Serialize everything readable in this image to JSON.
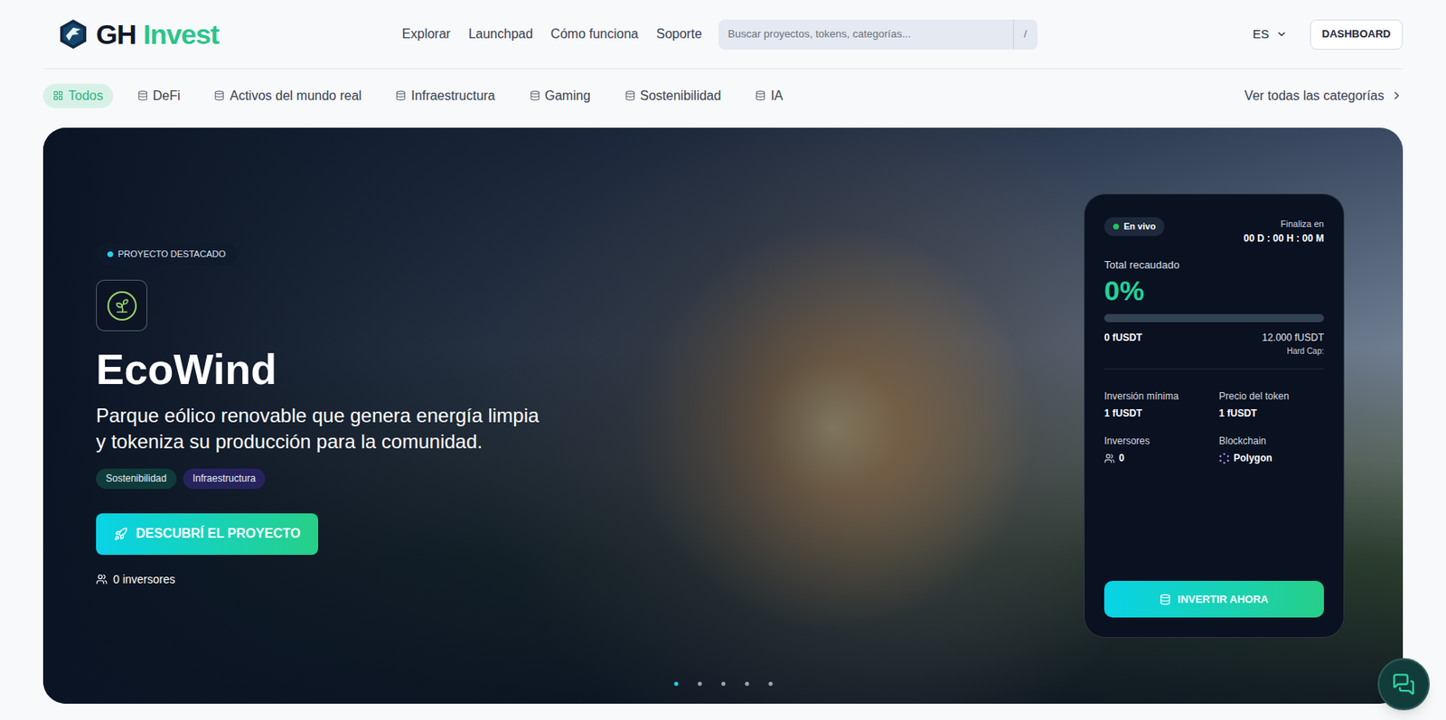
{
  "header": {
    "logo": {
      "prefix": "GH",
      "suffix": "Invest"
    },
    "nav": [
      "Explorar",
      "Launchpad",
      "Cómo funciona",
      "Soporte"
    ],
    "search": {
      "placeholder": "Buscar proyectos, tokens, categorías...",
      "shortcut": "/"
    },
    "language": "ES",
    "dashboard": "DASHBOARD"
  },
  "categories": {
    "items": [
      {
        "label": "Todos",
        "kind": "all",
        "selected": true
      },
      {
        "label": "DeFi",
        "kind": "category",
        "selected": false
      },
      {
        "label": "Activos del mundo real",
        "kind": "category",
        "selected": false
      },
      {
        "label": "Infraestructura",
        "kind": "category",
        "selected": false
      },
      {
        "label": "Gaming",
        "kind": "category",
        "selected": false
      },
      {
        "label": "Sostenibilidad",
        "kind": "category",
        "selected": false
      },
      {
        "label": "IA",
        "kind": "category",
        "selected": false
      }
    ],
    "see_all": "Ver todas las categorías"
  },
  "hero": {
    "badge": "PROYECTO DESTACADO",
    "title": "EcoWind",
    "description_lines": [
      "Parque eólico renovable que genera energía limpia",
      "y tokeniza su producción para la comunidad."
    ],
    "tags": [
      {
        "label": "Sostenibilidad",
        "color": "#0f3b3a"
      },
      {
        "label": "Infraestructura",
        "color": "#27235e"
      }
    ],
    "cta": "DESCUBRÍ EL PROYECTO",
    "investors": "0 inversores",
    "slides": [
      {
        "selected": true
      },
      {
        "selected": false
      },
      {
        "selected": false
      },
      {
        "selected": false
      },
      {
        "selected": false
      }
    ]
  },
  "sale_card": {
    "status": "En vivo",
    "ends_label": "Finaliza en",
    "countdown": "00 D : 00 H : 00 M",
    "raised_label": "Total recaudado",
    "raised_percent": "0%",
    "level": 0,
    "raised": "0 fUSDT",
    "hard_cap_value": "12.000 fUSDT",
    "hard_cap_label": "Hard Cap:",
    "stats": [
      {
        "label": "Inversión mínima",
        "value": "1 fUSDT",
        "kind": "plain"
      },
      {
        "label": "Precio del token",
        "value": "1 fUSDT",
        "kind": "plain"
      },
      {
        "label": "Inversores",
        "value": "0",
        "kind": "investors"
      },
      {
        "label": "Blockchain",
        "value": "Polygon",
        "kind": "chain"
      }
    ],
    "invest_button": "INVERTIR AHORA"
  }
}
